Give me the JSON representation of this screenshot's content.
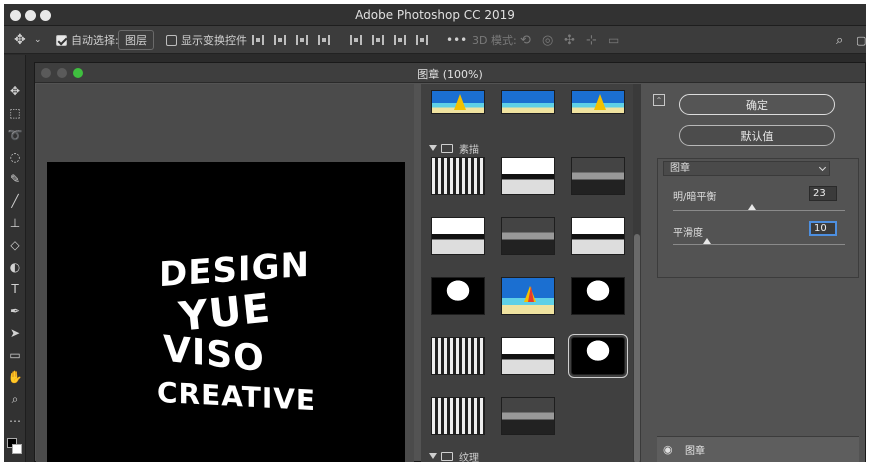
{
  "app": {
    "title": "Adobe Photoshop CC 2019"
  },
  "options_bar": {
    "auto_select_label": "自动选择:",
    "auto_select_value": "图层",
    "show_transform_label": "显示变换控件",
    "mode_3d_label": "3D 模式:"
  },
  "dialog": {
    "title": "图章 (100%)",
    "preview_art_lines": [
      "DESIGN",
      "YUE",
      "VISO",
      "CREATIVE"
    ],
    "gallery": {
      "folder_sketch": "素描",
      "folder_texture": "纹理"
    },
    "settings": {
      "ok_label": "确定",
      "default_label": "默认值",
      "filter_select": "图章",
      "param1_label": "明/暗平衡",
      "param1_value": "23",
      "param1_level": 0.46,
      "param2_label": "平滑度",
      "param2_value": "10",
      "param2_level": 0.2,
      "layer_label": "图章"
    }
  },
  "colors": {
    "accent_focus": "#4d8fe0",
    "traffic_green": "#3fbf3f"
  }
}
